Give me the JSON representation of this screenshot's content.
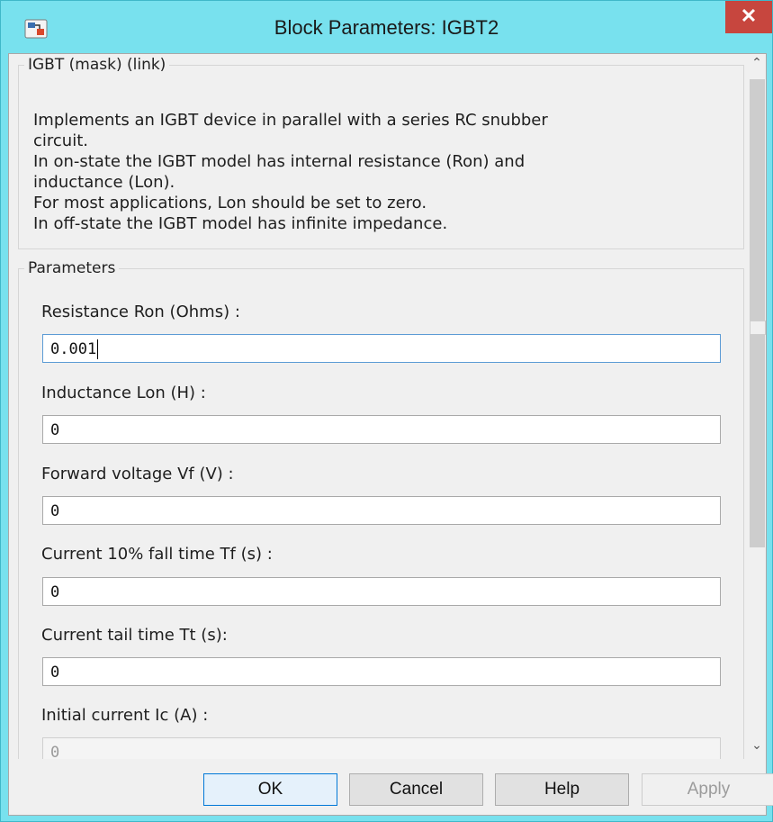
{
  "window": {
    "title": "Block Parameters: IGBT2",
    "close_glyph": "✕",
    "title_bar_color": "#78e1ee",
    "close_color": "#c7463e"
  },
  "icons": {
    "app": "simulink-block-icon",
    "close": "close-icon",
    "scroll_up": "chevron-up-icon",
    "scroll_down": "chevron-down-icon"
  },
  "description": {
    "legend": "IGBT (mask) (link)",
    "lines": [
      "Implements an IGBT device  in parallel with a series RC snubber",
      "circuit.",
      "In on-state the IGBT model has internal resistance (Ron) and",
      "inductance (Lon).",
      "For most applications, Lon should be set to zero.",
      "In off-state the IGBT model has infinite impedance."
    ]
  },
  "parameters": {
    "legend": "Parameters",
    "fields": [
      {
        "label": "Resistance Ron (Ohms) :",
        "value": "0.001"
      },
      {
        "label": "Inductance Lon (H) :",
        "value": "0"
      },
      {
        "label": "Forward voltage Vf (V) :",
        "value": "0"
      },
      {
        "label": "Current 10% fall time Tf (s) :",
        "value": "0"
      },
      {
        "label": "Current tail time Tt (s):",
        "value": "0"
      },
      {
        "label": "Initial current Ic (A) :",
        "value": "0"
      }
    ]
  },
  "scrollbar": {
    "up": "⌃",
    "down": "⌄",
    "position_fraction": 0.0
  },
  "buttons": {
    "ok": "OK",
    "cancel": "Cancel",
    "help": "Help",
    "apply": "Apply"
  }
}
